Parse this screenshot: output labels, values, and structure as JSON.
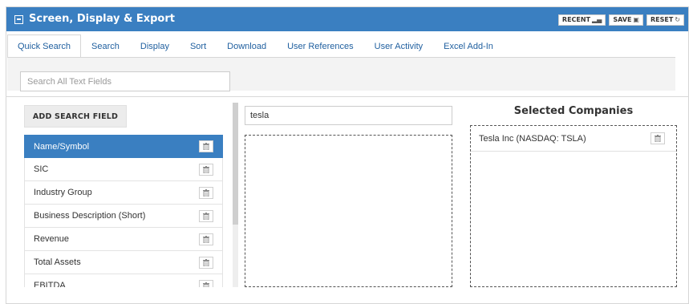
{
  "header": {
    "title": "Screen, Display & Export",
    "buttons": [
      {
        "label": "RECENT",
        "icon": "chart-icon"
      },
      {
        "label": "SAVE",
        "icon": "save-icon"
      },
      {
        "label": "RESET",
        "icon": "refresh-icon"
      }
    ]
  },
  "tabs": [
    {
      "label": "Quick Search",
      "active": true
    },
    {
      "label": "Search"
    },
    {
      "label": "Display"
    },
    {
      "label": "Sort"
    },
    {
      "label": "Download"
    },
    {
      "label": "User References"
    },
    {
      "label": "User Activity"
    },
    {
      "label": "Excel Add-In"
    }
  ],
  "search": {
    "placeholder": "Search All Text Fields",
    "value": ""
  },
  "add_field_label": "ADD SEARCH FIELD",
  "fields": [
    {
      "label": "Name/Symbol",
      "active": true
    },
    {
      "label": "SIC"
    },
    {
      "label": "Industry Group"
    },
    {
      "label": "Business Description (Short)"
    },
    {
      "label": "Revenue"
    },
    {
      "label": "Total Assets"
    },
    {
      "label": "EBITDA"
    }
  ],
  "query": {
    "value": "tesla"
  },
  "selected": {
    "title": "Selected Companies",
    "items": [
      "Tesla Inc (NASDAQ: TSLA)"
    ]
  },
  "colors": {
    "accent": "#3a7fc1"
  }
}
